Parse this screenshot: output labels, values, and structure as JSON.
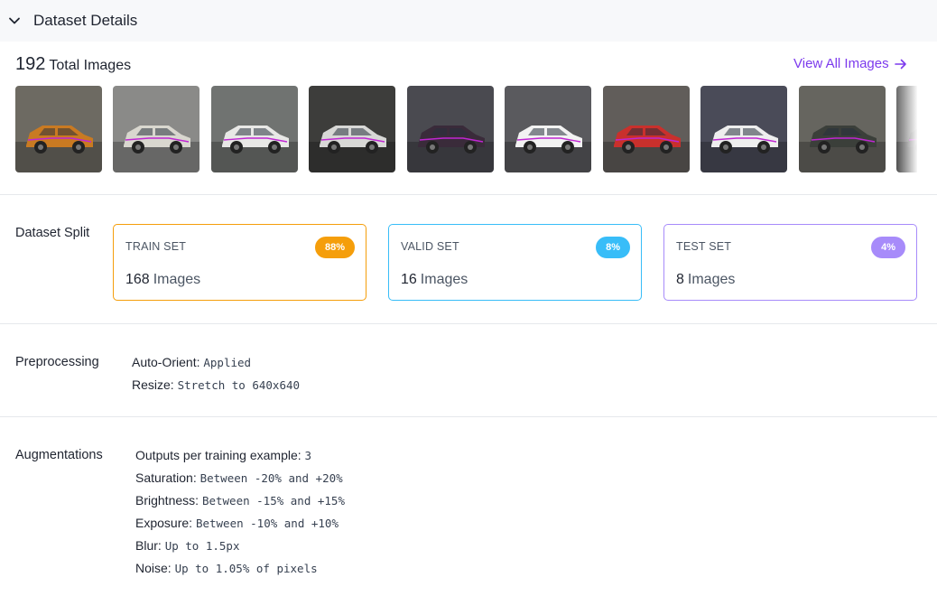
{
  "header": {
    "title": "Dataset Details",
    "icon": "chevron-down-icon"
  },
  "summary": {
    "count": "192",
    "count_label": "Total Images",
    "view_all": "View All Images"
  },
  "thumbnails": [
    {
      "bg": "#6d6a62",
      "car": "#c97a22"
    },
    {
      "bg": "#8a8a88",
      "car": "#d9d7cf"
    },
    {
      "bg": "#707371",
      "car": "#e8e8e6"
    },
    {
      "bg": "#3d3d3b",
      "car": "#d8d8d6"
    },
    {
      "bg": "#4a4a50",
      "car": "#3a2b3a"
    },
    {
      "bg": "#5a5a5e",
      "car": "#f2f2f2"
    },
    {
      "bg": "#615d5a",
      "car": "#c9302c"
    },
    {
      "bg": "#4a4b58",
      "car": "#eeeeee"
    },
    {
      "bg": "#66655f",
      "car": "#3b3f3a"
    },
    {
      "bg": "#6a6a6a",
      "car": "#555555"
    }
  ],
  "split": {
    "label": "Dataset Split",
    "cards": [
      {
        "name": "TRAIN SET",
        "percent": "88%",
        "count": "168",
        "unit": "Images",
        "color": "#f59e0b"
      },
      {
        "name": "VALID SET",
        "percent": "8%",
        "count": "16",
        "unit": "Images",
        "color": "#38bdf8"
      },
      {
        "name": "TEST SET",
        "percent": "4%",
        "count": "8",
        "unit": "Images",
        "color": "#a78bfa"
      }
    ]
  },
  "preprocessing": {
    "label": "Preprocessing",
    "items": [
      {
        "key": "Auto-Orient:",
        "value": "Applied"
      },
      {
        "key": "Resize:",
        "value": "Stretch to 640x640"
      }
    ]
  },
  "augmentations": {
    "label": "Augmentations",
    "items": [
      {
        "key": "Outputs per training example:",
        "value": "3"
      },
      {
        "key": "Saturation:",
        "value": "Between -20% and +20%"
      },
      {
        "key": "Brightness:",
        "value": "Between -15% and +15%"
      },
      {
        "key": "Exposure:",
        "value": "Between -10% and +10%"
      },
      {
        "key": "Blur:",
        "value": "Up to 1.5px"
      },
      {
        "key": "Noise:",
        "value": "Up to 1.05% of pixels"
      }
    ]
  }
}
